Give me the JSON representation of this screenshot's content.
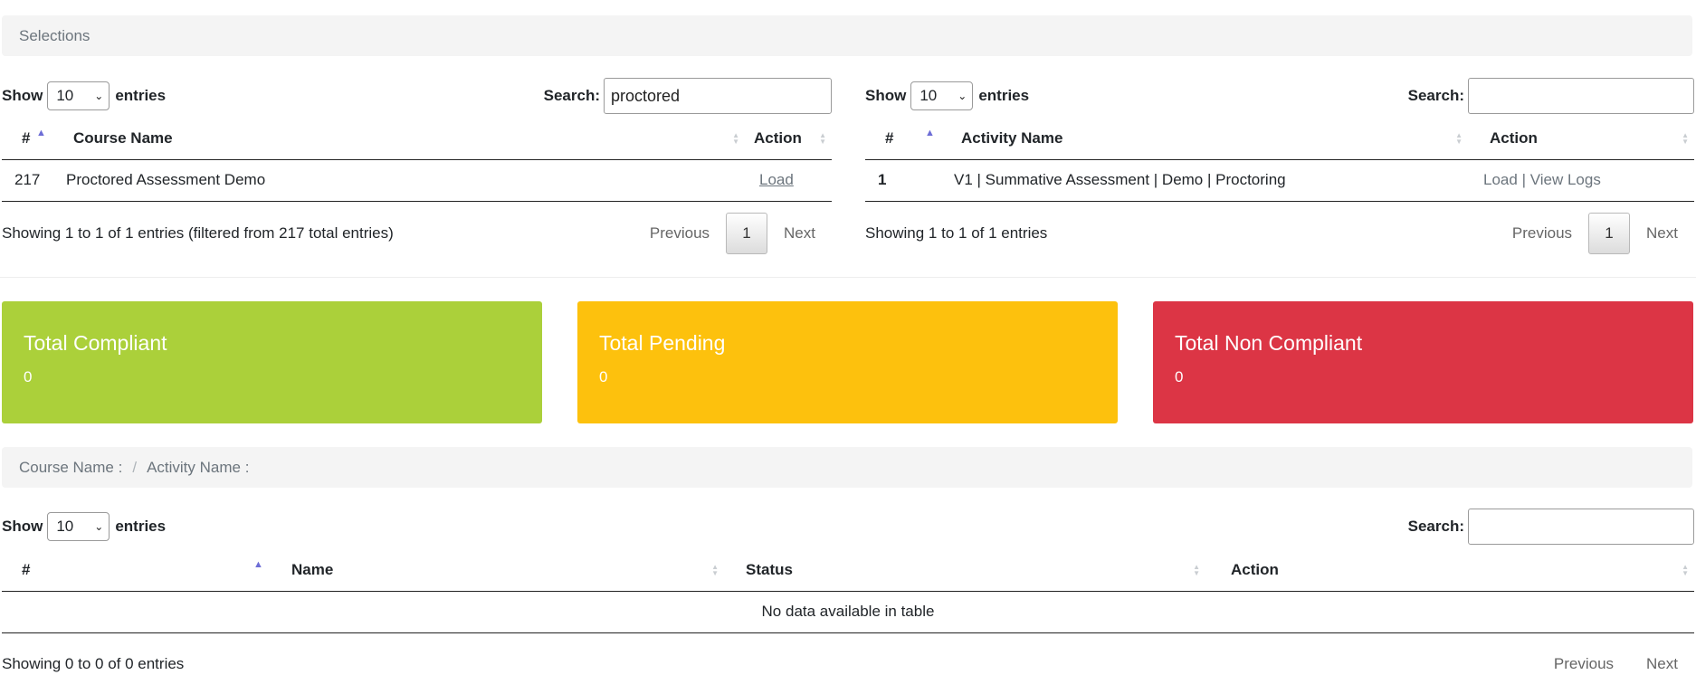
{
  "selections": {
    "label": "Selections"
  },
  "course_table": {
    "show_label": "Show",
    "entries_label": "entries",
    "length_value": "10",
    "search_label": "Search:",
    "search_value": "proctored",
    "headers": {
      "num": "#",
      "name": "Course Name",
      "action": "Action"
    },
    "rows": [
      {
        "num": "217",
        "name": "Proctored Assessment Demo",
        "action": "Load"
      }
    ],
    "info": "Showing 1 to 1 of 1 entries (filtered from 217 total entries)",
    "pager": {
      "prev": "Previous",
      "current": "1",
      "next": "Next"
    }
  },
  "activity_table": {
    "show_label": "Show",
    "entries_label": "entries",
    "length_value": "10",
    "search_label": "Search:",
    "search_value": "",
    "headers": {
      "num": "#",
      "name": "Activity Name",
      "action": "Action"
    },
    "rows": [
      {
        "num": "1",
        "name": "V1 | Summative Assessment | Demo | Proctoring",
        "load": "Load",
        "sep": "|",
        "logs": "View Logs"
      }
    ],
    "info": "Showing 1 to 1 of 1 entries",
    "pager": {
      "prev": "Previous",
      "current": "1",
      "next": "Next"
    }
  },
  "cards": {
    "compliant": {
      "title": "Total Compliant",
      "value": "0",
      "color": "#abd03a"
    },
    "pending": {
      "title": "Total Pending",
      "value": "0",
      "color": "#fdc10d"
    },
    "noncompliant": {
      "title": "Total Non Compliant",
      "value": "0",
      "color": "#dc3545"
    }
  },
  "breadcrumb": {
    "course": "Course Name :",
    "sep": "/",
    "activity": "Activity Name :"
  },
  "student_table": {
    "show_label": "Show",
    "entries_label": "entries",
    "length_value": "10",
    "search_label": "Search:",
    "search_value": "",
    "headers": {
      "num": "#",
      "name": "Name",
      "status": "Status",
      "action": "Action"
    },
    "empty": "No data available in table",
    "info": "Showing 0 to 0 of 0 entries",
    "pager": {
      "prev": "Previous",
      "next": "Next"
    }
  }
}
